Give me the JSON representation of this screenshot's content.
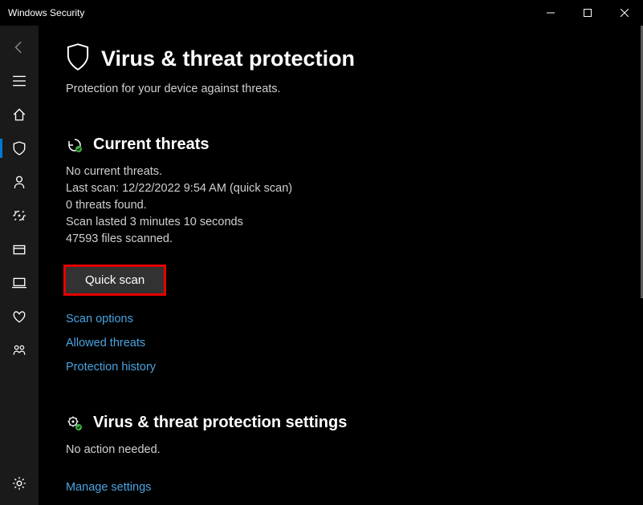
{
  "window": {
    "title": "Windows Security"
  },
  "page": {
    "title": "Virus & threat protection",
    "subtitle": "Protection for your device against threats."
  },
  "current_threats": {
    "title": "Current threats",
    "status": "No current threats.",
    "last_scan": "Last scan: 12/22/2022 9:54 AM (quick scan)",
    "threats_found": "0 threats found.",
    "scan_duration": "Scan lasted 3 minutes 10 seconds",
    "files_scanned": "47593 files scanned.",
    "button": "Quick scan",
    "links": {
      "scan_options": "Scan options",
      "allowed_threats": "Allowed threats",
      "protection_history": "Protection history"
    }
  },
  "settings_section": {
    "title": "Virus & threat protection settings",
    "status": "No action needed.",
    "links": {
      "manage": "Manage settings"
    }
  }
}
